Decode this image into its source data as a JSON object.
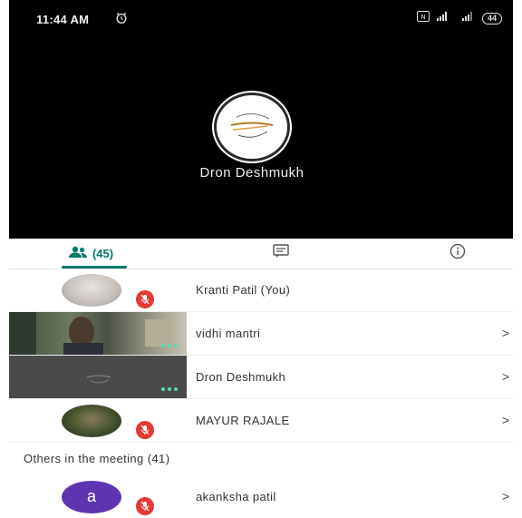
{
  "status_bar": {
    "time": "11:44 AM",
    "battery": "44"
  },
  "stage": {
    "speaker_name": "Dron Deshmukh"
  },
  "tabs": {
    "people_count": "(45)"
  },
  "participants": [
    {
      "name": "Kranti Patil (You)",
      "muted": true,
      "has_chevron": false
    },
    {
      "name": "vidhi mantri",
      "muted": false,
      "has_chevron": true,
      "chevron": ">"
    },
    {
      "name": "Dron Deshmukh",
      "muted": false,
      "has_chevron": true,
      "chevron": ">"
    },
    {
      "name": "MAYUR RAJALE",
      "muted": true,
      "has_chevron": true,
      "chevron": ">"
    }
  ],
  "others": {
    "header": "Others in the meeting (41)",
    "items": [
      {
        "initial": "a",
        "name": "akanksha patil",
        "muted": true,
        "chevron": ">"
      }
    ]
  },
  "colors": {
    "accent": "#00796b",
    "mute_red": "#e53935",
    "avatar_purple": "#5e35b1"
  }
}
